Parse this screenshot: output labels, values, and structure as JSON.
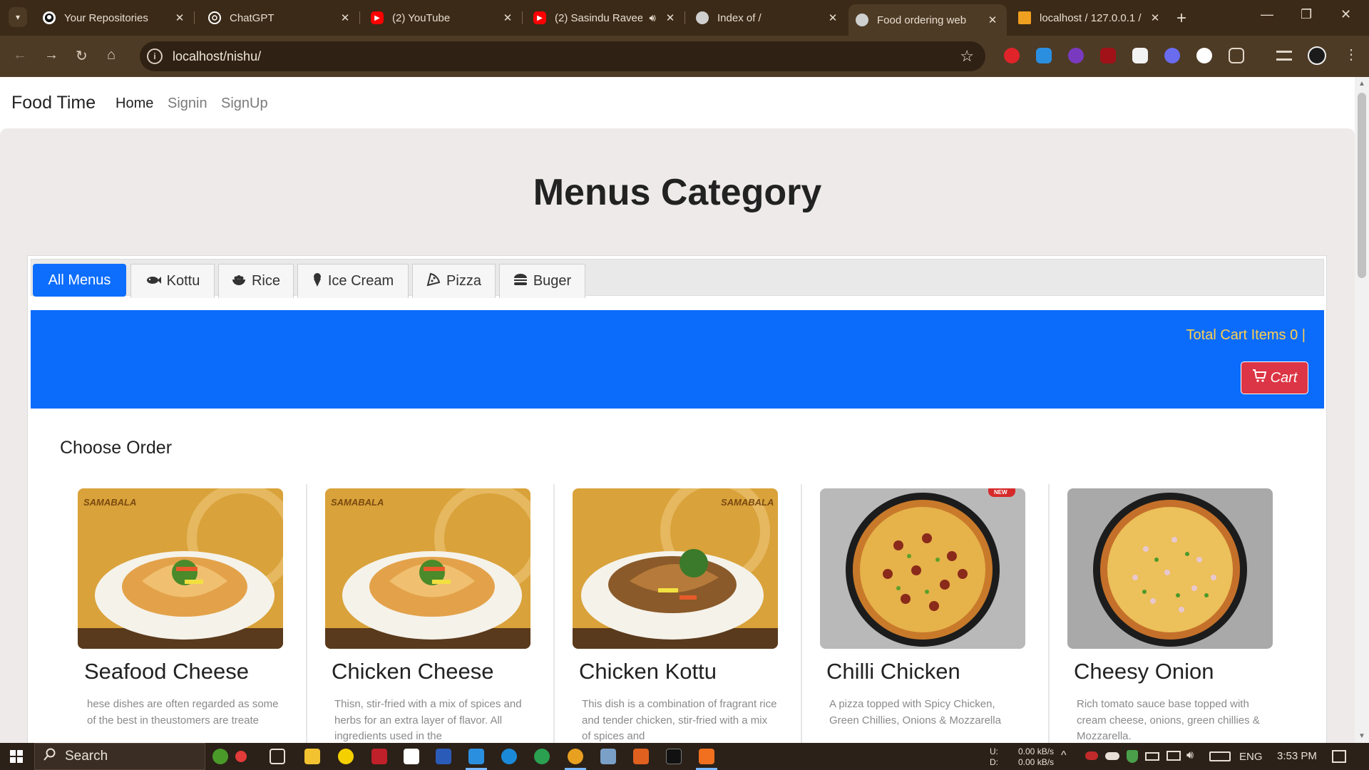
{
  "browser": {
    "tabs": [
      {
        "title": "Your Repositories",
        "icon": "github-icon",
        "color": "#ffffff"
      },
      {
        "title": "ChatGPT",
        "icon": "chatgpt-icon",
        "color": "#ffffff"
      },
      {
        "title": "(2) YouTube",
        "icon": "youtube-icon",
        "color": "#ff0000"
      },
      {
        "title": "(2) Sasindu Ravee",
        "icon": "youtube-icon",
        "color": "#ff0000"
      },
      {
        "title": "Index of /",
        "icon": "globe-icon",
        "color": "#cfcfcf"
      },
      {
        "title": "Food ordering web",
        "icon": "globe-icon",
        "color": "#cfcfcf"
      },
      {
        "title": "localhost / 127.0.0.1 /",
        "icon": "phpmyadmin-icon",
        "color": "#f0a020"
      }
    ],
    "url": "localhost/nishu/"
  },
  "site": {
    "brand": "Food Time",
    "nav": [
      "Home",
      "Signin",
      "SignUp"
    ]
  },
  "page": {
    "title": "Menus Category",
    "categories": [
      {
        "label": "All Menus",
        "icon": ""
      },
      {
        "label": "Kottu",
        "icon": "fish-icon"
      },
      {
        "label": "Rice",
        "icon": "rice-bowl-icon"
      },
      {
        "label": "Ice Cream",
        "icon": "ice-cream-icon"
      },
      {
        "label": "Pizza",
        "icon": "pizza-icon"
      },
      {
        "label": "Buger",
        "icon": "burger-icon"
      }
    ],
    "cart_total": "Total Cart Items 0 |",
    "cart_button": "Cart",
    "section_title": "Choose Order",
    "items": [
      {
        "name": "Seafood Cheese",
        "desc": "hese dishes are often regarded as some of the best in theustomers are treate",
        "image": "kottu-plate",
        "watermark": "SAMABALA"
      },
      {
        "name": "Chicken Cheese",
        "desc": "Thisn, stir-fried with a mix of spices and herbs for an extra layer of flavor. All ingredients used in the",
        "image": "kottu-plate",
        "watermark": "SAMABALA"
      },
      {
        "name": "Chicken Kottu",
        "desc": "This dish is a combination of fragrant rice and tender chicken, stir-fried with a mix of spices and",
        "image": "kottu-plate",
        "watermark": "SAMABALA"
      },
      {
        "name": "Chilli Chicken",
        "desc": "A pizza topped with Spicy Chicken, Green Chillies, Onions & Mozzarella",
        "image": "pizza-chicken",
        "watermark": "NEW"
      },
      {
        "name": "Cheesy Onion",
        "desc": "Rich tomato sauce base topped with cream cheese, onions, green chillies & Mozzarella.",
        "image": "pizza-onion",
        "watermark": ""
      }
    ]
  },
  "taskbar": {
    "search": "Search",
    "net_up": "0.00 kB/s",
    "net_down": "0.00 kB/s",
    "net_up_label": "U:",
    "net_down_label": "D:",
    "lang": "ENG",
    "time": "3:53 PM"
  }
}
